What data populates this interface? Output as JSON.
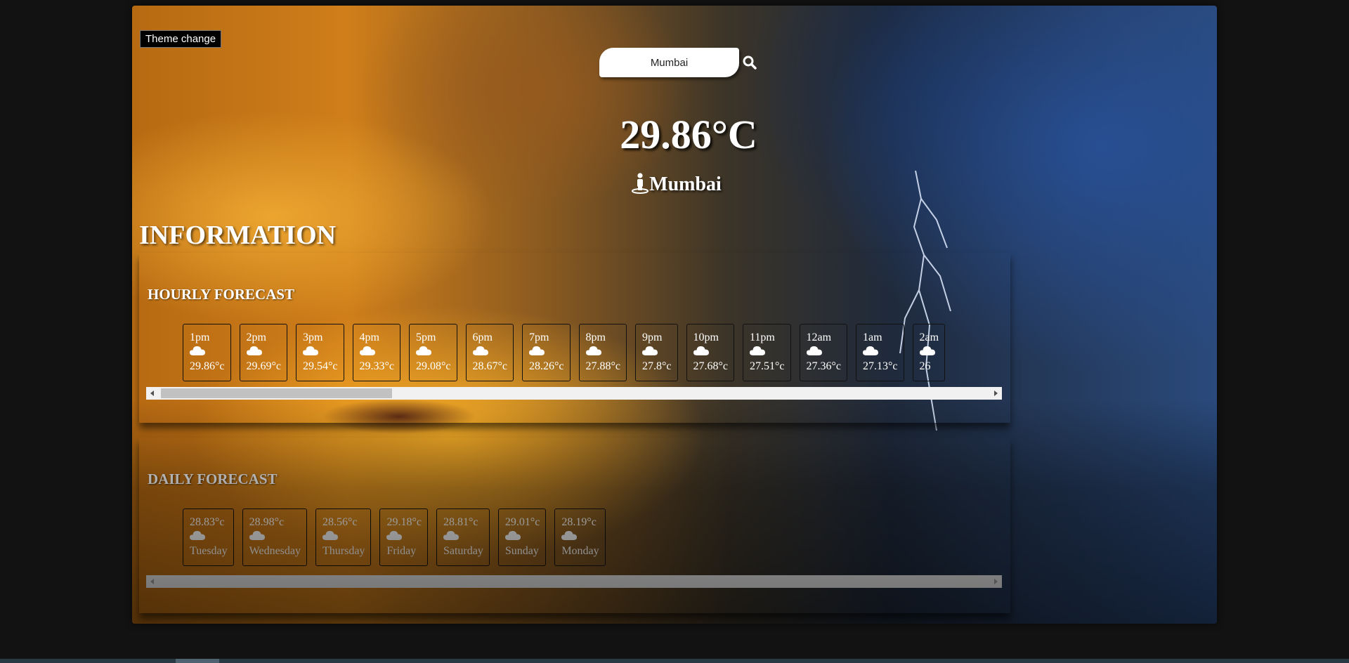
{
  "theme_button": {
    "label": "Theme change"
  },
  "search": {
    "value": "Mumbai"
  },
  "current": {
    "temperature": "29.86°C",
    "location": "Mumbai"
  },
  "information": {
    "heading": "INFORMATION"
  },
  "hourly": {
    "title": "HOURLY FORECAST",
    "scroll_position": 0.0,
    "visible_fraction": 0.28,
    "items": [
      {
        "time": "1pm",
        "temp": "29.86°c",
        "icon": "cloud-icon"
      },
      {
        "time": "2pm",
        "temp": "29.69°c",
        "icon": "cloud-icon"
      },
      {
        "time": "3pm",
        "temp": "29.54°c",
        "icon": "cloud-icon"
      },
      {
        "time": "4pm",
        "temp": "29.33°c",
        "icon": "cloud-icon"
      },
      {
        "time": "5pm",
        "temp": "29.08°c",
        "icon": "cloud-icon"
      },
      {
        "time": "6pm",
        "temp": "28.67°c",
        "icon": "cloud-icon"
      },
      {
        "time": "7pm",
        "temp": "28.26°c",
        "icon": "cloud-icon"
      },
      {
        "time": "8pm",
        "temp": "27.88°c",
        "icon": "cloud-icon"
      },
      {
        "time": "9pm",
        "temp": "27.8°c",
        "icon": "cloud-icon"
      },
      {
        "time": "10pm",
        "temp": "27.68°c",
        "icon": "cloud-icon"
      },
      {
        "time": "11pm",
        "temp": "27.51°c",
        "icon": "cloud-icon"
      },
      {
        "time": "12am",
        "temp": "27.36°c",
        "icon": "cloud-icon"
      },
      {
        "time": "1am",
        "temp": "27.13°c",
        "icon": "cloud-icon"
      },
      {
        "time": "2am",
        "temp": "26",
        "icon": "cloud-icon"
      }
    ]
  },
  "daily": {
    "title": "DAILY FORECAST",
    "items": [
      {
        "temp": "28.83°c",
        "day": "Tuesday",
        "icon": "cloud-icon"
      },
      {
        "temp": "28.98°c",
        "day": "Wednesday",
        "icon": "cloud-icon"
      },
      {
        "temp": "28.56°c",
        "day": "Thursday",
        "icon": "cloud-icon"
      },
      {
        "temp": "29.18°c",
        "day": "Friday",
        "icon": "cloud-icon"
      },
      {
        "temp": "28.81°c",
        "day": "Saturday",
        "icon": "cloud-icon"
      },
      {
        "temp": "29.01°c",
        "day": "Sunday",
        "icon": "cloud-icon"
      },
      {
        "temp": "28.19°c",
        "day": "Monday",
        "icon": "cloud-icon"
      }
    ]
  },
  "colors": {
    "page_background": "#121212",
    "text": "#ffffff",
    "card_border": "#111111",
    "scrollbar_track": "#f1f1f1",
    "scrollbar_thumb": "#c1c1c1"
  }
}
